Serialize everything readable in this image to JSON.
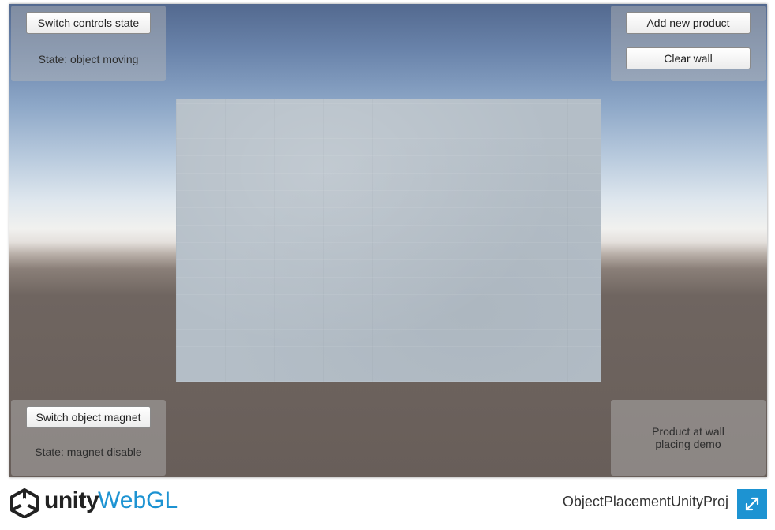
{
  "controls_panel": {
    "switch_button_label": "Switch controls state",
    "state_text": "State: object moving"
  },
  "product_panel": {
    "add_button_label": "Add new product",
    "clear_button_label": "Clear wall"
  },
  "magnet_panel": {
    "switch_button_label": "Switch object magnet",
    "state_text": "State: magnet disable"
  },
  "info_panel": {
    "line1": "Product at wall",
    "line2": "placing demo"
  },
  "footer": {
    "logo_unity": "unity",
    "logo_webgl": "WebGL",
    "project_title": "ObjectPlacementUnityProj",
    "fullscreen_icon": "fullscreen-icon"
  },
  "colors": {
    "webgl_accent": "#1d93d2",
    "panel_bg": "rgba(185,185,185,0.45)"
  }
}
